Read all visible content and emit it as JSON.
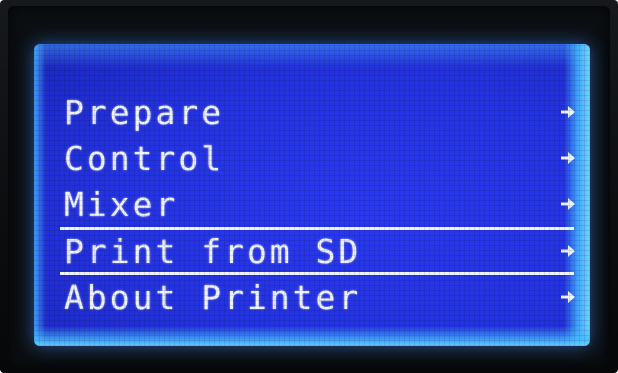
{
  "screen": {
    "menu": {
      "items": [
        {
          "label": "Prepare",
          "arrow": "right-arrow-icon"
        },
        {
          "label": "Control",
          "arrow": "right-arrow-icon"
        },
        {
          "label": "Mixer",
          "arrow": "right-arrow-icon"
        },
        {
          "label": "Print from SD",
          "arrow": "right-arrow-icon",
          "selected": true
        },
        {
          "label": "About Printer",
          "arrow": "right-arrow-icon"
        }
      ]
    }
  },
  "colors": {
    "lcd_background": "#2433e0",
    "lcd_text": "#eef3ff",
    "backlight_edge": "#46beff",
    "bezel": "#0c0f12"
  }
}
